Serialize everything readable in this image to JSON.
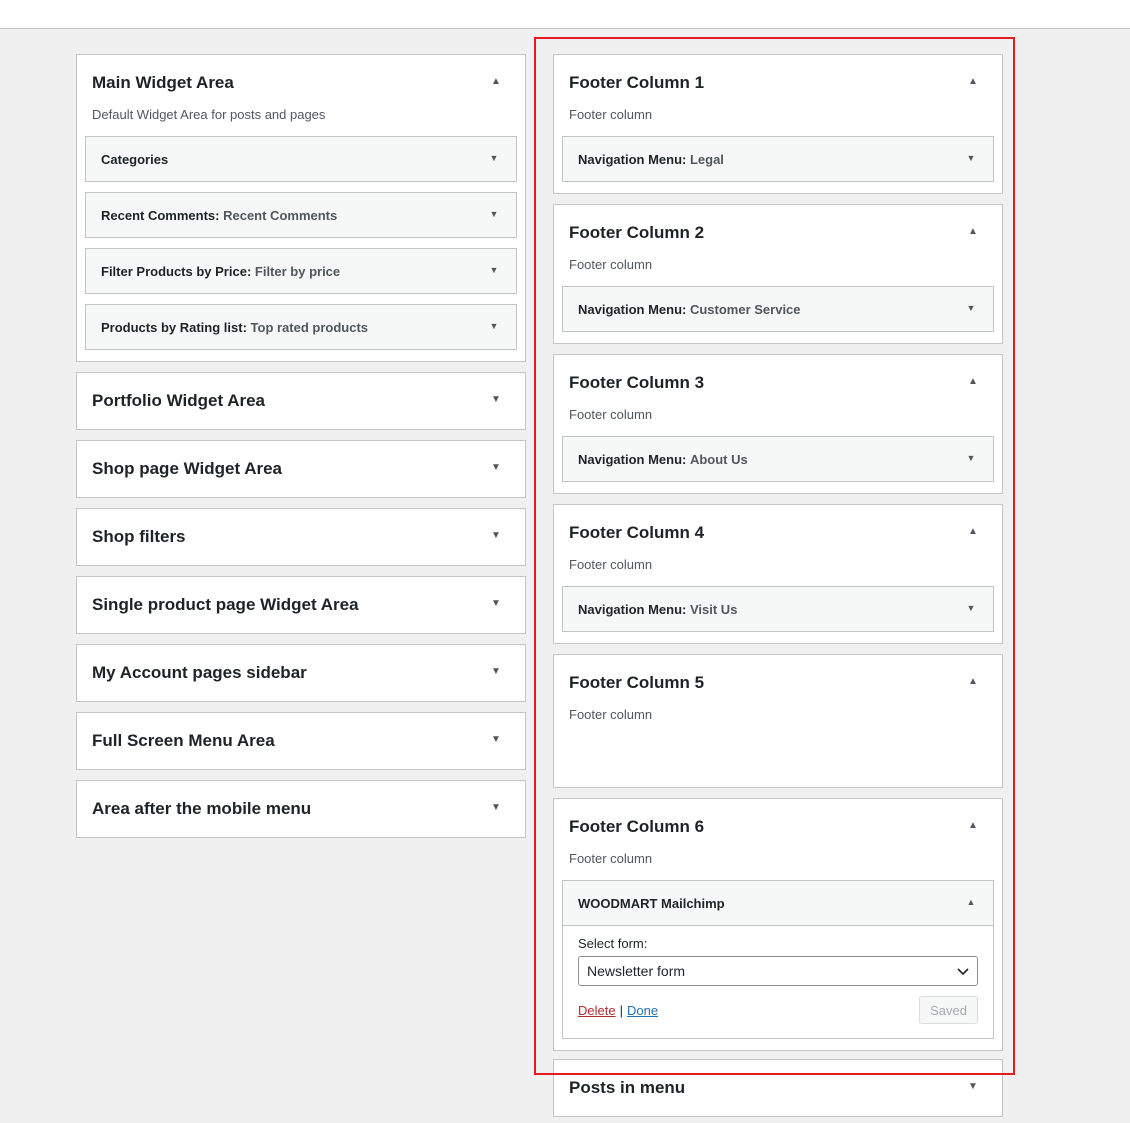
{
  "left_areas": [
    {
      "title": "Main Widget Area",
      "description": "Default Widget Area for posts and pages",
      "expanded": true,
      "widgets": [
        {
          "name": "Categories",
          "instance": ""
        },
        {
          "name": "Recent Comments",
          "instance": "Recent Comments"
        },
        {
          "name": "Filter Products by Price",
          "instance": "Filter by price"
        },
        {
          "name": "Products by Rating list",
          "instance": "Top rated products"
        }
      ]
    },
    {
      "title": "Portfolio Widget Area",
      "expanded": false
    },
    {
      "title": "Shop page Widget Area",
      "expanded": false
    },
    {
      "title": "Shop filters",
      "expanded": false
    },
    {
      "title": "Single product page Widget Area",
      "expanded": false
    },
    {
      "title": "My Account pages sidebar",
      "expanded": false
    },
    {
      "title": "Full Screen Menu Area",
      "expanded": false
    },
    {
      "title": "Area after the mobile menu",
      "expanded": false
    }
  ],
  "right_areas": [
    {
      "title": "Footer Column 1",
      "description": "Footer column",
      "widgets": [
        {
          "name": "Navigation Menu",
          "instance": "Legal"
        }
      ]
    },
    {
      "title": "Footer Column 2",
      "description": "Footer column",
      "widgets": [
        {
          "name": "Navigation Menu",
          "instance": "Customer Service"
        }
      ]
    },
    {
      "title": "Footer Column 3",
      "description": "Footer column",
      "widgets": [
        {
          "name": "Navigation Menu",
          "instance": "About Us"
        }
      ]
    },
    {
      "title": "Footer Column 4",
      "description": "Footer column",
      "widgets": [
        {
          "name": "Navigation Menu",
          "instance": "Visit Us"
        }
      ]
    },
    {
      "title": "Footer Column 5",
      "description": "Footer column",
      "widgets": []
    },
    {
      "title": "Footer Column 6",
      "description": "Footer column",
      "mailchimp": {
        "name": "WOODMART Mailchimp",
        "select_label": "Select form:",
        "select_value": "Newsletter form",
        "delete_label": "Delete",
        "separator": "|",
        "done_label": "Done",
        "saved_label": "Saved"
      }
    },
    {
      "title": "Posts in menu",
      "expanded": false
    }
  ],
  "icons": {
    "collapse": "arrow-up-icon",
    "expand": "arrow-down-icon"
  },
  "colors": {
    "highlight": "#e31b23",
    "link": "#2271b1",
    "delete": "#b32d2e"
  }
}
